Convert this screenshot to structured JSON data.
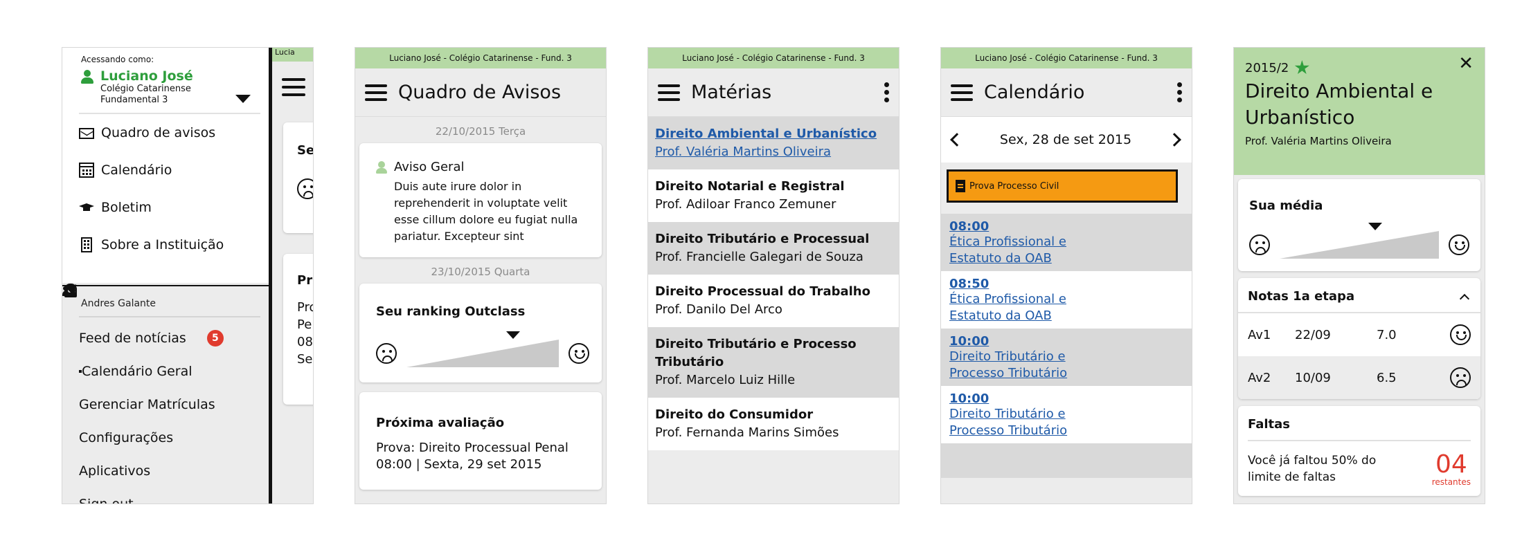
{
  "status_text": "Luciano José - Colégio Catarinense - Fund. 3",
  "status_text_cut": "Lucia",
  "screen1": {
    "accessing_label": "Acessando como:",
    "user_name": "Luciano José",
    "school": "Colégio Catarinense",
    "grade": "Fundamental 3",
    "menu": [
      {
        "label": "Quadro de avisos",
        "icon": "mail-icon"
      },
      {
        "label": "Calendário",
        "icon": "calendar-icon"
      },
      {
        "label": "Boletim",
        "icon": "graduation-cap-icon"
      },
      {
        "label": "Sobre a Instituição",
        "icon": "building-icon"
      }
    ],
    "section_label": "Andres Galante",
    "menu2": [
      {
        "label": "Feed de notícias",
        "icon": "bell-icon",
        "badge": "5"
      },
      {
        "label": "Calendário Geral",
        "icon": "calendar-icon"
      },
      {
        "label": "Gerenciar Matrículas",
        "icon": "users-icon"
      },
      {
        "label": "Configurações",
        "icon": "gear-icon"
      },
      {
        "label": "Aplicativos",
        "icon": "rocket-icon"
      },
      {
        "label": "Sign out",
        "icon": "sign-out-icon"
      }
    ],
    "behind_card1": "Se",
    "behind_card2_title": "Pr",
    "behind_card2_lines": [
      "Pro",
      "Pe",
      "08",
      "Se"
    ]
  },
  "screen2": {
    "title": "Quadro de Avisos",
    "date1": "22/10/2015 Terça",
    "aviso_title": "Aviso Geral",
    "aviso_body": "Duis aute irure dolor in reprehenderit in voluptate velit esse cillum dolore eu fugiat nulla pariatur. Excepteur sint",
    "date2": "23/10/2015 Quarta",
    "ranking_title": "Seu ranking Outclass",
    "ranking_level": 0.7,
    "prox_title": "Próxima avaliação",
    "prox_line1": "Prova: Direito Processual Penal",
    "prox_line2": "08:00 | Sexta, 29 set 2015"
  },
  "screen3": {
    "title": "Matérias",
    "subjects": [
      {
        "name": "Direito Ambiental e Urbanístico",
        "prof": "Prof. Valéria Martins Oliveira"
      },
      {
        "name": "Direito Notarial e Registral",
        "prof": "Prof. Adiloar Franco Zemuner"
      },
      {
        "name": "Direito Tributário e Processual",
        "prof": "Prof. Francielle Galegari de Souza"
      },
      {
        "name": "Direito Processual do Trabalho",
        "prof": "Prof. Danilo Del Arco"
      },
      {
        "name": "Direito Tributário e Processo Tributário",
        "prof": "Prof. Marcelo Luiz Hille"
      },
      {
        "name": "Direito do Consumidor",
        "prof": "Prof. Fernanda Marins Simões"
      }
    ]
  },
  "screen4": {
    "title": "Calendário",
    "date": "Sex, 28 de set 2015",
    "event": "Prova Processo Civil",
    "items": [
      {
        "time": "08:00",
        "subject": "Ética Profissional e Estatuto da OAB"
      },
      {
        "time": "08:50",
        "subject": "Ética Profissional e Estatuto da OAB"
      },
      {
        "time": "10:00",
        "subject": "Direito Tributário e Processo Tributário"
      },
      {
        "time": "10:00",
        "subject": "Direito Tributário e Processo Tributário"
      }
    ]
  },
  "screen5": {
    "period": "2015/2",
    "title": "Direito Ambiental e Urbanístico",
    "prof": "Prof. Valéria Martins Oliveira",
    "media_title": "Sua média",
    "media_level": 0.6,
    "notas_title": "Notas 1a etapa",
    "notas": [
      {
        "av": "Av1",
        "date": "22/09",
        "grade": "7.0",
        "mood": "happy"
      },
      {
        "av": "Av2",
        "date": "10/09",
        "grade": "6.5",
        "mood": "sad"
      }
    ],
    "faltas_title": "Faltas",
    "faltas_text": "Você já faltou 50% do limite de faltas",
    "faltas_count": "04",
    "faltas_label": "restantes"
  },
  "colors": {
    "green_status": "#b6d9a5",
    "green_user": "#2e9e3c",
    "link_blue": "#1f5aa8",
    "badge_red": "#e03b2e",
    "event_orange": "#f59a12"
  }
}
